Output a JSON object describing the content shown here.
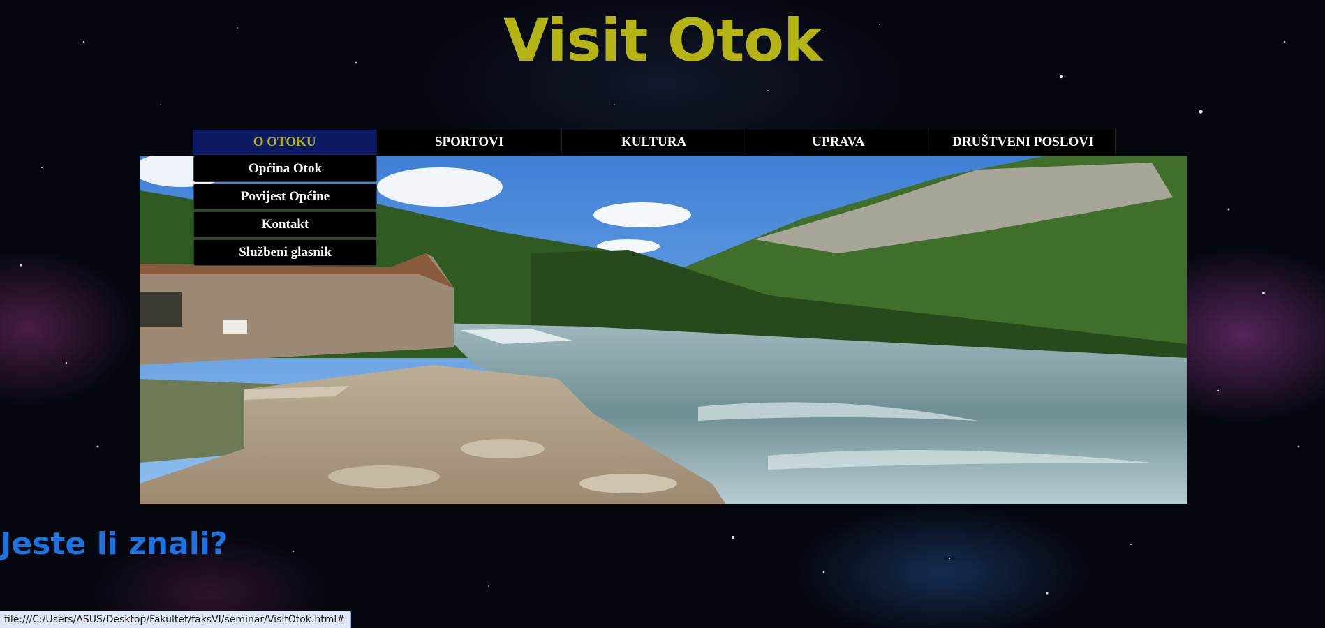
{
  "header": {
    "title": "Visit Otok"
  },
  "nav": {
    "items": [
      {
        "label": "O OTOKU",
        "active": true
      },
      {
        "label": "SPORTOVI",
        "active": false
      },
      {
        "label": "KULTURA",
        "active": false
      },
      {
        "label": "UPRAVA",
        "active": false
      },
      {
        "label": "DRUŠTVENI POSLOVI",
        "active": false
      }
    ],
    "dropdown": [
      {
        "label": "Općina Otok"
      },
      {
        "label": "Povijest Općine"
      },
      {
        "label": "Kontakt"
      },
      {
        "label": "Službeni glasnik"
      }
    ]
  },
  "main": {
    "subheading": "Jeste li znali?"
  },
  "status_bar": {
    "url": "file:///C:/Users/ASUS/Desktop/Fakultet/faksVI/seminar/VisitOtok.html#"
  },
  "colors": {
    "title": "#b4b414",
    "nav_active_bg": "#0c1a63",
    "nav_bg": "#000000",
    "subheading": "#1d74e0",
    "page_bg": "#05070f"
  }
}
